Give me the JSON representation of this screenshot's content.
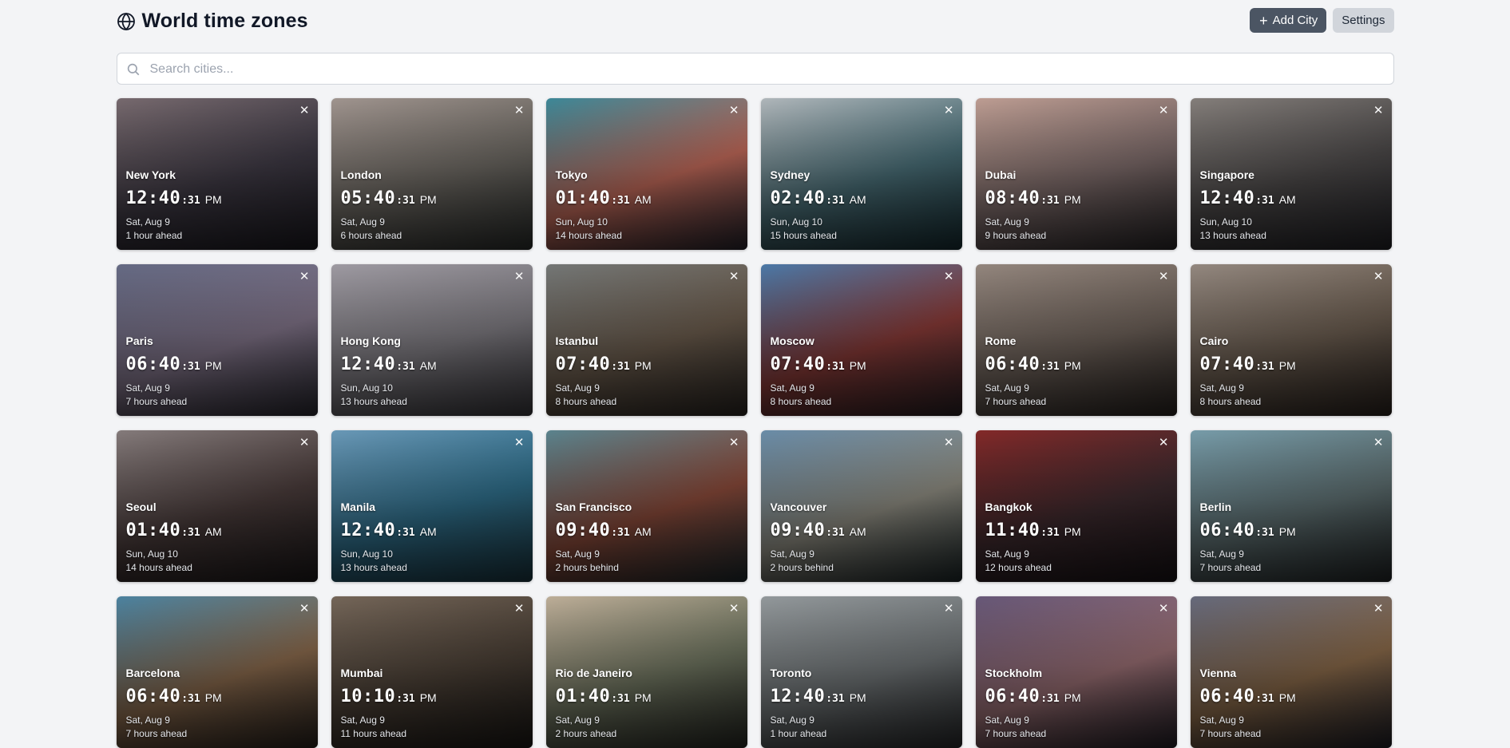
{
  "header": {
    "title": "World time zones",
    "add_city_label": "Add City",
    "settings_label": "Settings"
  },
  "search": {
    "placeholder": "Search cities...",
    "value": ""
  },
  "cards": [
    {
      "city": "New York",
      "hm": "12:40",
      "sec": ":31",
      "ampm": "PM",
      "date": "Sat, Aug 9",
      "offset": "1 hour ahead",
      "bg": [
        "#7d6f74",
        "#3f3a45",
        "#1f1d24"
      ]
    },
    {
      "city": "London",
      "hm": "05:40",
      "sec": ":31",
      "ampm": "PM",
      "date": "Sat, Aug 9",
      "offset": "6 hours ahead",
      "bg": [
        "#a89c96",
        "#6c6862",
        "#2f3230"
      ]
    },
    {
      "city": "Tokyo",
      "hm": "01:40",
      "sec": ":31",
      "ampm": "AM",
      "date": "Sun, Aug 10",
      "offset": "14 hours ahead",
      "bg": [
        "#3f8fa0",
        "#c26a5a",
        "#2a2730"
      ]
    },
    {
      "city": "Sydney",
      "hm": "02:40",
      "sec": ":31",
      "ampm": "AM",
      "date": "Sun, Aug 10",
      "offset": "15 hours ahead",
      "bg": [
        "#b9c0c4",
        "#4a6f78",
        "#183036"
      ]
    },
    {
      "city": "Dubai",
      "hm": "08:40",
      "sec": ":31",
      "ampm": "PM",
      "date": "Sat, Aug 9",
      "offset": "9 hours ahead",
      "bg": [
        "#c7a59a",
        "#7d6b6a",
        "#2d2a2c"
      ]
    },
    {
      "city": "Singapore",
      "hm": "12:40",
      "sec": ":31",
      "ampm": "AM",
      "date": "Sun, Aug 10",
      "offset": "13 hours ahead",
      "bg": [
        "#8b8581",
        "#4d4a4a",
        "#25252a"
      ]
    },
    {
      "city": "Paris",
      "hm": "06:40",
      "sec": ":31",
      "ampm": "PM",
      "date": "Sat, Aug 9",
      "offset": "7 hours ahead",
      "bg": [
        "#6a6f8a",
        "#807388",
        "#2e2d36"
      ]
    },
    {
      "city": "Hong Kong",
      "hm": "12:40",
      "sec": ":31",
      "ampm": "AM",
      "date": "Sun, Aug 10",
      "offset": "13 hours ahead",
      "bg": [
        "#a6a2aa",
        "#7f7c82",
        "#3e3d42"
      ]
    },
    {
      "city": "Istanbul",
      "hm": "07:40",
      "sec": ":31",
      "ampm": "PM",
      "date": "Sat, Aug 9",
      "offset": "8 hours ahead",
      "bg": [
        "#7a7d7c",
        "#6b5c4d",
        "#2e2925"
      ]
    },
    {
      "city": "Moscow",
      "hm": "07:40",
      "sec": ":31",
      "ampm": "PM",
      "date": "Sat, Aug 9",
      "offset": "8 hours ahead",
      "bg": [
        "#4f7fb0",
        "#8a3b38",
        "#2b2226"
      ]
    },
    {
      "city": "Rome",
      "hm": "06:40",
      "sec": ":31",
      "ampm": "PM",
      "date": "Sat, Aug 9",
      "offset": "7 hours ahead",
      "bg": [
        "#9b8d84",
        "#6e625a",
        "#2c2623"
      ]
    },
    {
      "city": "Cairo",
      "hm": "07:40",
      "sec": ":31",
      "ampm": "PM",
      "date": "Sat, Aug 9",
      "offset": "8 hours ahead",
      "bg": [
        "#9b8f86",
        "#6b5d50",
        "#2e2621"
      ]
    },
    {
      "city": "Seoul",
      "hm": "01:40",
      "sec": ":31",
      "ampm": "AM",
      "date": "Sun, Aug 10",
      "offset": "14 hours ahead",
      "bg": [
        "#8b8181",
        "#4a3c3b",
        "#1f1b1c"
      ]
    },
    {
      "city": "Manila",
      "hm": "12:40",
      "sec": ":31",
      "ampm": "AM",
      "date": "Sun, Aug 10",
      "offset": "13 hours ahead",
      "bg": [
        "#6fa0c0",
        "#2f6e8a",
        "#1c3a45"
      ]
    },
    {
      "city": "San Francisco",
      "hm": "09:40",
      "sec": ":31",
      "ampm": "AM",
      "date": "Sat, Aug 9",
      "offset": "2 hours behind",
      "bg": [
        "#5f8a95",
        "#8a4a3a",
        "#1f2c30"
      ]
    },
    {
      "city": "Vancouver",
      "hm": "09:40",
      "sec": ":31",
      "ampm": "AM",
      "date": "Sat, Aug 9",
      "offset": "2 hours behind",
      "bg": [
        "#6f93b0",
        "#8f8d82",
        "#1f2a2c"
      ]
    },
    {
      "city": "Bangkok",
      "hm": "11:40",
      "sec": ":31",
      "ampm": "PM",
      "date": "Sat, Aug 9",
      "offset": "12 hours ahead",
      "bg": [
        "#8a2b2b",
        "#3d2a2e",
        "#1a1418"
      ]
    },
    {
      "city": "Berlin",
      "hm": "06:40",
      "sec": ":31",
      "ampm": "PM",
      "date": "Sat, Aug 9",
      "offset": "7 hours ahead",
      "bg": [
        "#7da4b2",
        "#5d6e70",
        "#25292a"
      ]
    },
    {
      "city": "Barcelona",
      "hm": "06:40",
      "sec": ":31",
      "ampm": "PM",
      "date": "Sat, Aug 9",
      "offset": "7 hours ahead",
      "bg": [
        "#4f89a8",
        "#8a6a4d",
        "#2c2520"
      ]
    },
    {
      "city": "Mumbai",
      "hm": "10:10",
      "sec": ":31",
      "ampm": "PM",
      "date": "Sat, Aug 9",
      "offset": "11 hours ahead",
      "bg": [
        "#7a6b5d",
        "#4b4036",
        "#1e1b18"
      ]
    },
    {
      "city": "Rio de Janeiro",
      "hm": "01:40",
      "sec": ":31",
      "ampm": "PM",
      "date": "Sat, Aug 9",
      "offset": "2 hours ahead",
      "bg": [
        "#c7b7a0",
        "#6f7560",
        "#2a2c26"
      ]
    },
    {
      "city": "Toronto",
      "hm": "12:40",
      "sec": ":31",
      "ampm": "PM",
      "date": "Sat, Aug 9",
      "offset": "1 hour ahead",
      "bg": [
        "#9aa0a3",
        "#707577",
        "#2c2e30"
      ]
    },
    {
      "city": "Stockholm",
      "hm": "06:40",
      "sec": ":31",
      "ampm": "PM",
      "date": "Sat, Aug 9",
      "offset": "7 hours ahead",
      "bg": [
        "#6c5c7e",
        "#9a6f74",
        "#26222a"
      ]
    },
    {
      "city": "Vienna",
      "hm": "06:40",
      "sec": ":31",
      "ampm": "PM",
      "date": "Sat, Aug 9",
      "offset": "7 hours ahead",
      "bg": [
        "#6b6f82",
        "#8a6a4a",
        "#22222a"
      ]
    }
  ]
}
